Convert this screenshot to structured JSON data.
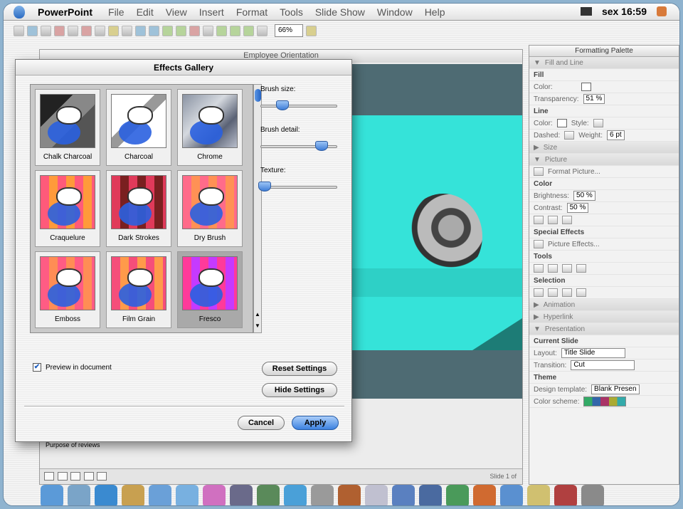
{
  "menubar": {
    "app": "PowerPoint",
    "items": [
      "File",
      "Edit",
      "View",
      "Insert",
      "Format",
      "Tools",
      "Slide Show",
      "Window",
      "Help"
    ],
    "clock": "sex 16:59"
  },
  "toolbar": {
    "zoom": "66%"
  },
  "document": {
    "title": "Employee Orientation",
    "notes": "Purpose of reviews",
    "slide_counter": "Slide 1 of"
  },
  "dialog": {
    "title": "Effects Gallery",
    "effects": [
      {
        "label": "Chalk Charcoal",
        "style": "t-chalk"
      },
      {
        "label": "Charcoal",
        "style": "t-charcoal"
      },
      {
        "label": "Chrome",
        "style": "t-chrome"
      },
      {
        "label": "Craquelure",
        "style": "t-craq"
      },
      {
        "label": "Dark Strokes",
        "style": "t-dark"
      },
      {
        "label": "Dry Brush",
        "style": "t-dry"
      },
      {
        "label": "Emboss",
        "style": "t-emboss"
      },
      {
        "label": "Film Grain",
        "style": "t-film"
      },
      {
        "label": "Fresco",
        "style": "t-fresco"
      }
    ],
    "selected": "Fresco",
    "settings": [
      {
        "label": "Brush size:",
        "value": 0.28
      },
      {
        "label": "Brush detail:",
        "value": 0.78
      },
      {
        "label": "Texture:",
        "value": 0.05
      }
    ],
    "preview_label": "Preview in document",
    "reset_label": "Reset Settings",
    "hide_label": "Hide Settings",
    "cancel_label": "Cancel",
    "apply_label": "Apply"
  },
  "palette": {
    "title": "Formatting Palette",
    "fill_and_line": "Fill and Line",
    "fill": "Fill",
    "color": "Color:",
    "transparency": "Transparency:",
    "transparency_value": "51 %",
    "line": "Line",
    "style": "Style:",
    "dashed": "Dashed:",
    "weight": "Weight:",
    "weight_value": "6 pt",
    "size": "Size",
    "picture": "Picture",
    "format_picture": "Format Picture...",
    "color_group": "Color",
    "brightness": "Brightness:",
    "brightness_value": "50 %",
    "contrast": "Contrast:",
    "contrast_value": "50 %",
    "special_effects": "Special Effects",
    "picture_effects": "Picture Effects...",
    "tools": "Tools",
    "selection": "Selection",
    "animation": "Animation",
    "hyperlink": "Hyperlink",
    "presentation": "Presentation",
    "current_slide": "Current Slide",
    "layout": "Layout:",
    "layout_value": "Title Slide",
    "transition": "Transition:",
    "transition_value": "Cut",
    "theme": "Theme",
    "design_template": "Design template:",
    "design_value": "Blank Presen",
    "color_scheme": "Color scheme:"
  }
}
